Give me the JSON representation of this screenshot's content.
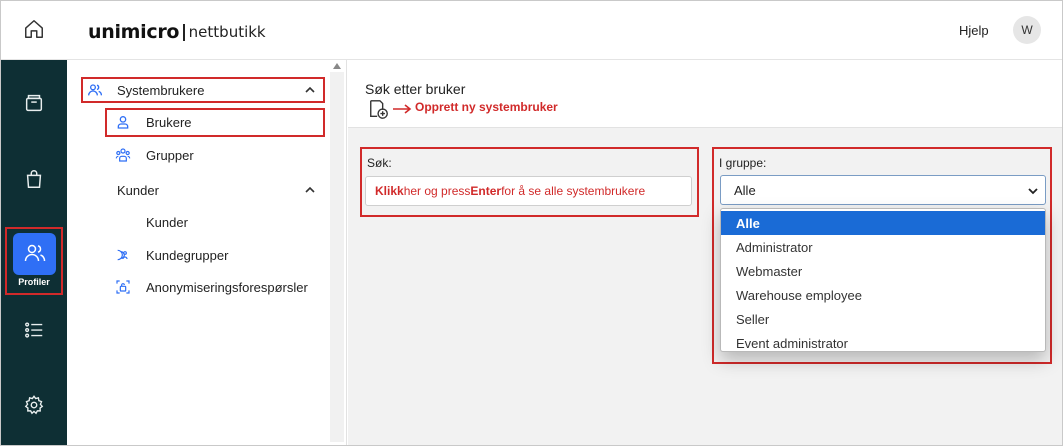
{
  "brand": {
    "name": "unimicro",
    "sub": "nettbutikk"
  },
  "header": {
    "help": "Hjelp",
    "avatar": "W"
  },
  "rail": {
    "items": [
      {
        "icon": "home-icon"
      },
      {
        "icon": "archive-icon"
      },
      {
        "icon": "shopping-bag-icon"
      },
      {
        "icon": "users-icon",
        "label": "Profiler",
        "active": true
      },
      {
        "icon": "list-icon"
      },
      {
        "icon": "gear-icon"
      }
    ]
  },
  "subnav": {
    "items": [
      {
        "label": "Systembrukere",
        "icon": "users-icon",
        "expanded": true
      },
      {
        "label": "Brukere",
        "icon": "user-icon",
        "selected": true
      },
      {
        "label": "Grupper",
        "icon": "group-icon"
      },
      {
        "label": "Kunder",
        "expanded": true
      },
      {
        "label": "Kunder"
      },
      {
        "label": "Kundegrupper",
        "icon": "customer-group-icon"
      },
      {
        "label": "Anonymiseringsforespørsler",
        "icon": "anonymize-icon"
      }
    ]
  },
  "main": {
    "title": "Søk etter bruker",
    "create_link": "Opprett ny systembruker",
    "search": {
      "label": "Søk:",
      "placeholder_parts": [
        "Klikk",
        " her og press ",
        "Enter",
        " for å se alle systembrukere"
      ]
    },
    "group": {
      "label": "I gruppe:",
      "selected": "Alle",
      "options": [
        "Alle",
        "Administrator",
        "Webmaster",
        "Warehouse employee",
        "Seller",
        "Event administrator"
      ]
    }
  },
  "colors": {
    "rail_bg": "#0e2f34",
    "accent": "#2f6ff5",
    "highlight": "#d12a2a",
    "selected_option": "#1a6bd6"
  }
}
